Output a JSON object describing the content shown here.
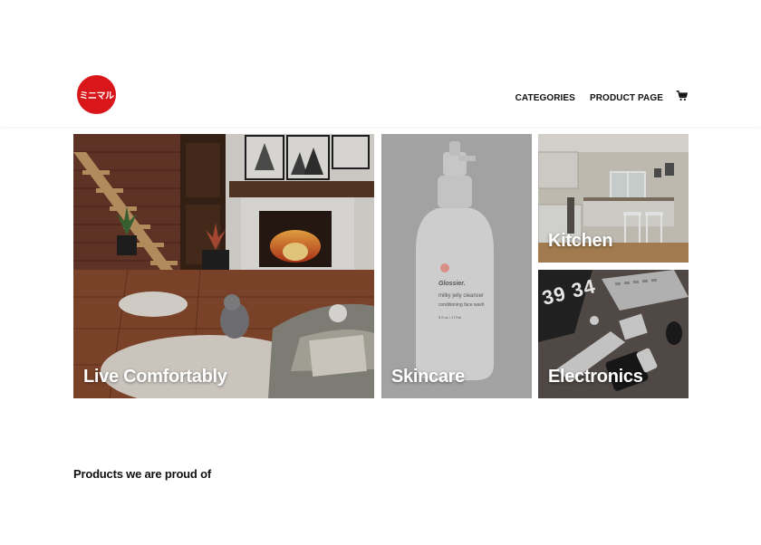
{
  "brand": {
    "logo_text": "ミニマル",
    "logo_color": "#d9171b"
  },
  "nav": {
    "categories": "CATEGORIES",
    "product_page": "PRODUCT PAGE",
    "cart_icon": "shopping-cart-icon"
  },
  "tiles": [
    {
      "label": "Live Comfortably"
    },
    {
      "label": "Skincare"
    },
    {
      "label": "Kitchen"
    },
    {
      "label": "Electronics"
    }
  ],
  "product_card": {
    "brand": "Glossier.",
    "name": "milky jelly cleanser",
    "desc": "conditioning face wash",
    "size": "5 fl oz / 177ml"
  },
  "electronics_screen_text": "39 34",
  "products_section": {
    "title": "Products we are proud of"
  }
}
